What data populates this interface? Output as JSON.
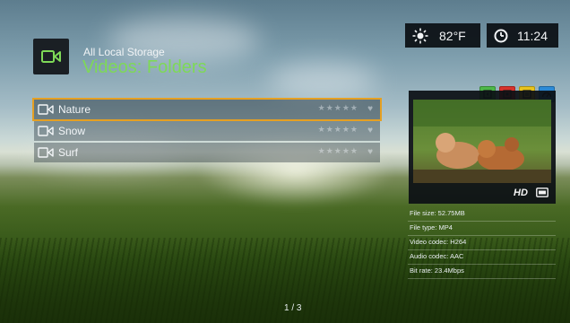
{
  "header": {
    "breadcrumb": "All Local Storage",
    "title": "Videos: Folders"
  },
  "status": {
    "weather_icon": "sun-icon",
    "temperature": "82°F",
    "clock_icon": "clock-icon",
    "time": "11:24"
  },
  "color_buttons": [
    {
      "name": "green-button",
      "color": "#4db848"
    },
    {
      "name": "red-button",
      "color": "#d8322c"
    },
    {
      "name": "yellow-button",
      "color": "#e8c31c"
    },
    {
      "name": "blue-button",
      "color": "#2b8ad6"
    }
  ],
  "folders": [
    {
      "label": "Nature",
      "selected": true,
      "rating": "★★★★★",
      "fav": "♥"
    },
    {
      "label": "Snow",
      "selected": false,
      "rating": "★★★★★",
      "fav": "♥"
    },
    {
      "label": "Surf",
      "selected": false,
      "rating": "★★★★★",
      "fav": "♥"
    }
  ],
  "preview": {
    "hd_label": "HD"
  },
  "file_info": [
    "File size: 52.75MB",
    "File type: MP4",
    "Video codec: H264",
    "Audio codec: AAC",
    "Bit rate: 23.4Mbps"
  ],
  "pager": "1 / 3",
  "colors": {
    "accent_green": "#7ed957",
    "selection": "#e5a023"
  }
}
